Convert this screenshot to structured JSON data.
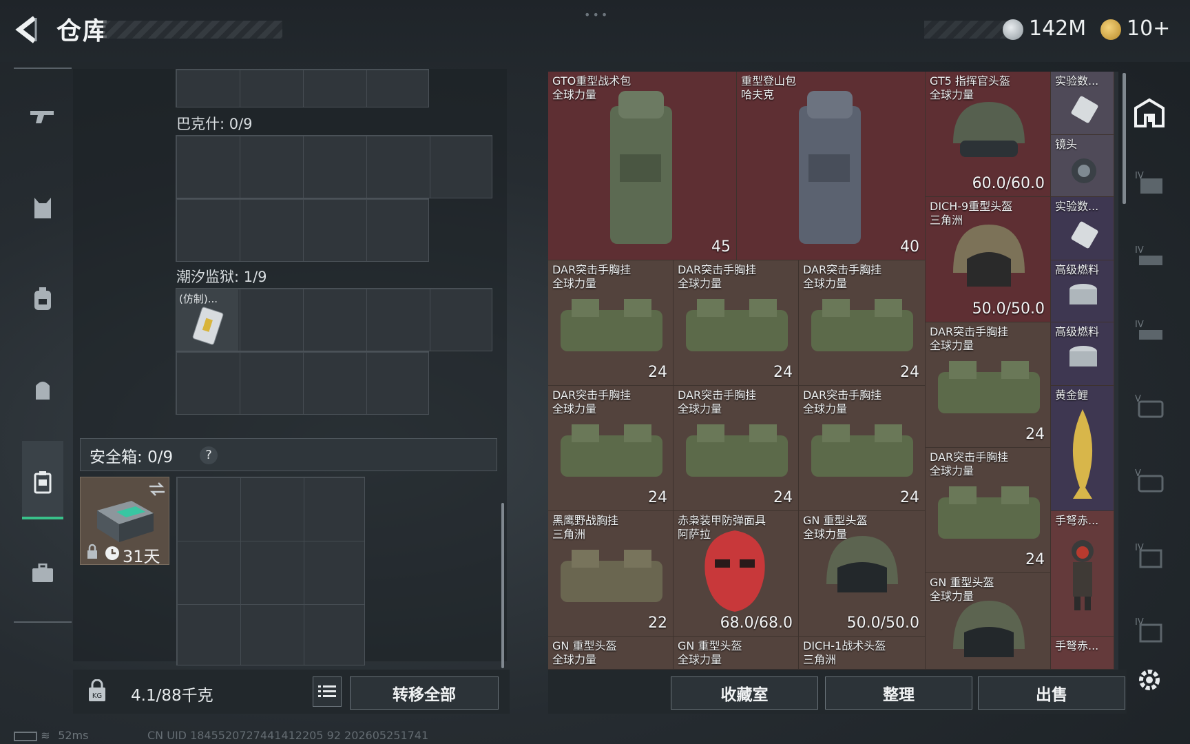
{
  "header": {
    "title": "仓库",
    "currency_1": "142M",
    "currency_2": "10+"
  },
  "left_panel": {
    "sections": [
      {
        "label": "巴克什: 0/9"
      },
      {
        "label": "潮汐监狱: 1/9",
        "items": [
          {
            "name": "(仿制)..."
          }
        ]
      }
    ],
    "safe_box": {
      "label": "安全箱:",
      "count": "0/9",
      "help": "?",
      "case_timer": "31天"
    },
    "weight": "4.1/88千克",
    "transfer_all_label": "转移全部"
  },
  "inventory": {
    "items": [
      {
        "name": "GTO重型战术包",
        "sub": "全球力量",
        "value": "45",
        "color": "red"
      },
      {
        "name": "重型登山包",
        "sub": "哈夫克",
        "value": "40",
        "color": "red"
      },
      {
        "name": "GT5 指挥官头盔",
        "sub": "全球力量",
        "value": "60.0/60.0",
        "color": "red"
      },
      {
        "name": "实验数...",
        "sub": "",
        "value": "",
        "color": "small"
      },
      {
        "name": "镜头",
        "sub": "",
        "value": "",
        "color": "small"
      },
      {
        "name": "DICH-9重型头盔",
        "sub": "三角洲",
        "value": "50.0/50.0",
        "color": "red"
      },
      {
        "name": "实验数...",
        "sub": "",
        "value": "",
        "color": "purple"
      },
      {
        "name": "高级燃料",
        "sub": "",
        "value": "",
        "color": "purple"
      },
      {
        "name": "DAR突击手胸挂",
        "sub": "全球力量",
        "value": "24",
        "color": "brown"
      },
      {
        "name": "DAR突击手胸挂",
        "sub": "全球力量",
        "value": "24",
        "color": "brown"
      },
      {
        "name": "DAR突击手胸挂",
        "sub": "全球力量",
        "value": "24",
        "color": "brown"
      },
      {
        "name": "DAR突击手胸挂",
        "sub": "全球力量",
        "value": "24",
        "color": "brown"
      },
      {
        "name": "高级燃料",
        "sub": "",
        "value": "",
        "color": "purple"
      },
      {
        "name": "DAR突击手胸挂",
        "sub": "全球力量",
        "value": "24",
        "color": "brown"
      },
      {
        "name": "DAR突击手胸挂",
        "sub": "全球力量",
        "value": "24",
        "color": "brown"
      },
      {
        "name": "DAR突击手胸挂",
        "sub": "全球力量",
        "value": "24",
        "color": "brown"
      },
      {
        "name": "黄金鲤",
        "sub": "",
        "value": "",
        "color": "purple"
      },
      {
        "name": "DAR突击手胸挂",
        "sub": "全球力量",
        "value": "24",
        "color": "brown"
      },
      {
        "name": "黑鹰野战胸挂",
        "sub": "三角洲",
        "value": "22",
        "color": "brown"
      },
      {
        "name": "赤枭装甲防弹面具",
        "sub": "阿萨拉",
        "value": "68.0/68.0",
        "color": "brown"
      },
      {
        "name": "GN 重型头盔",
        "sub": "全球力量",
        "value": "50.0/50.0",
        "color": "brown"
      },
      {
        "name": "手弩赤...",
        "sub": "",
        "value": "",
        "color": "rose"
      },
      {
        "name": "GN 重型头盔",
        "sub": "全球力量",
        "value": "",
        "color": "brown"
      },
      {
        "name": "GN 重型头盔",
        "sub": "全球力量",
        "value": "",
        "color": "brown"
      },
      {
        "name": "GN 重型头盔",
        "sub": "全球力量",
        "value": "",
        "color": "brown"
      },
      {
        "name": "DICH-1战术头盔",
        "sub": "三角洲",
        "value": "",
        "color": "brown"
      },
      {
        "name": "手弩赤...",
        "sub": "",
        "value": "",
        "color": "rose"
      }
    ],
    "buttons": {
      "collection": "收藏室",
      "organize": "整理",
      "sell": "出售"
    }
  },
  "status_bar": {
    "ping": "52ms",
    "uid": "CN UID 1845520727441412205 92 202605251741"
  }
}
